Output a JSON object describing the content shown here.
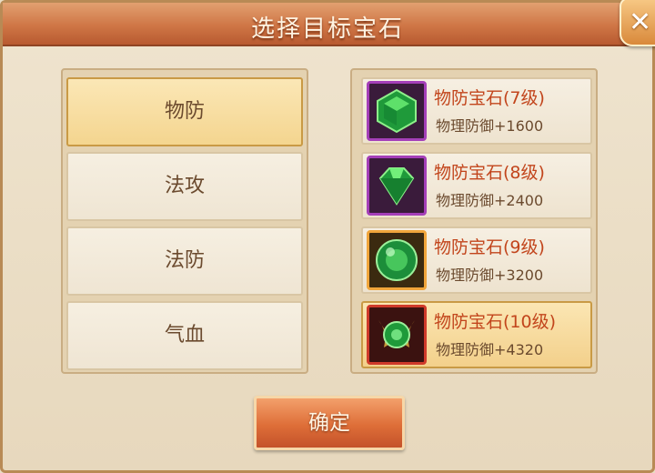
{
  "dialog": {
    "title": "选择目标宝石",
    "confirm_label": "确定"
  },
  "categories": [
    {
      "label": "物防",
      "selected": true
    },
    {
      "label": "法攻",
      "selected": false
    },
    {
      "label": "法防",
      "selected": false
    },
    {
      "label": "气血",
      "selected": false
    }
  ],
  "gems": [
    {
      "name": "物防宝石(7级)",
      "stat": "物理防御+1600",
      "frame_color": "#a43fb8",
      "icon": "green-hexagon-gem-icon"
    },
    {
      "name": "物防宝石(8级)",
      "stat": "物理防御+2400",
      "frame_color": "#a43fb8",
      "icon": "green-diamond-gem-icon"
    },
    {
      "name": "物防宝石(9级)",
      "stat": "物理防御+3200",
      "frame_color": "#f0a53b",
      "icon": "green-orb-gem-icon"
    },
    {
      "name": "物防宝石(10级)",
      "stat": "物理防御+4320",
      "frame_color": "#cf3a2a",
      "icon": "ornate-green-gem-icon",
      "selected": true
    }
  ]
}
